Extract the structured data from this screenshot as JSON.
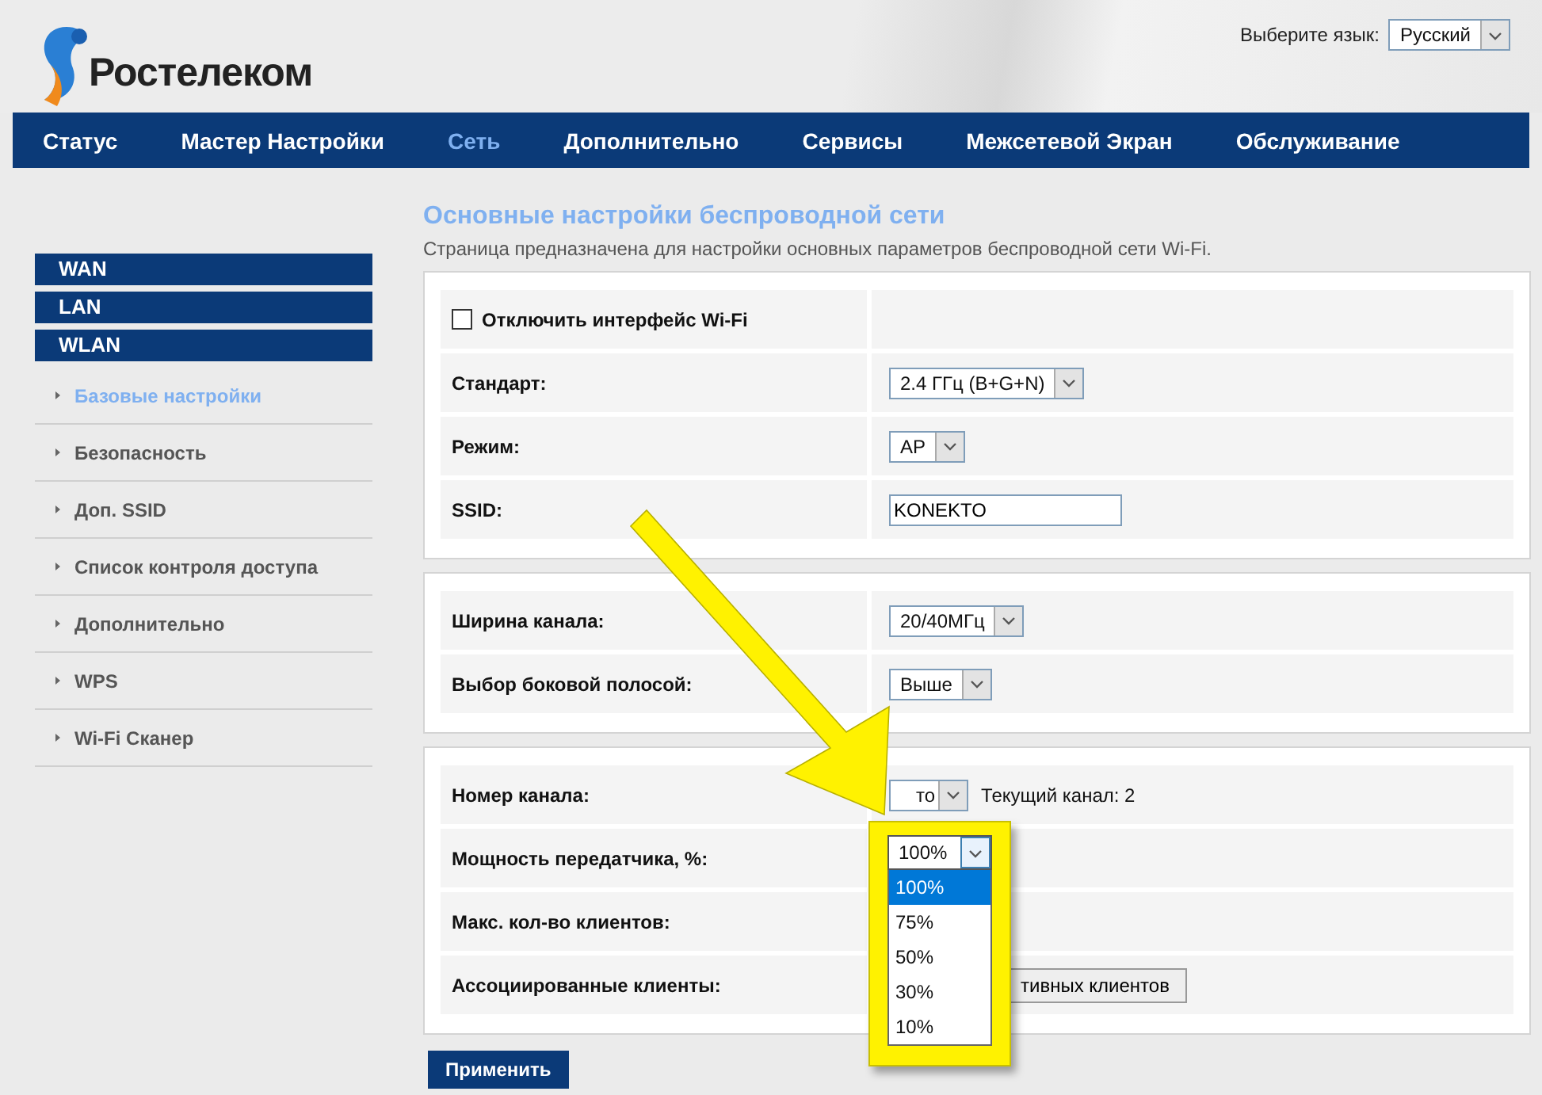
{
  "logo": {
    "text": "Ростелеком"
  },
  "language": {
    "label": "Выберите язык:",
    "value": "Русский"
  },
  "nav": [
    {
      "label": "Статус",
      "selected": false
    },
    {
      "label": "Мастер Настройки",
      "selected": false
    },
    {
      "label": "Сеть",
      "selected": true
    },
    {
      "label": "Дополнительно",
      "selected": false
    },
    {
      "label": "Сервисы",
      "selected": false
    },
    {
      "label": "Межсетевой Экран",
      "selected": false
    },
    {
      "label": "Обслуживание",
      "selected": false
    }
  ],
  "sidebar": {
    "groups": [
      "WAN",
      "LAN",
      "WLAN"
    ],
    "items": [
      {
        "label": "Базовые настройки",
        "selected": true
      },
      {
        "label": "Безопасность",
        "selected": false
      },
      {
        "label": "Доп. SSID",
        "selected": false
      },
      {
        "label": "Список контроля доступа",
        "selected": false
      },
      {
        "label": "Дополнительно",
        "selected": false
      },
      {
        "label": "WPS",
        "selected": false
      },
      {
        "label": "Wi-Fi Сканер",
        "selected": false
      }
    ]
  },
  "page": {
    "title": "Основные настройки беспроводной сети",
    "subtitle": "Страница предназначена для настройки основных параметров беспроводной сети Wi-Fi."
  },
  "sections": [
    {
      "rows": [
        {
          "kind": "checkbox",
          "label": "Отключить интерфейс Wi-Fi",
          "checked": false
        },
        {
          "kind": "select",
          "label": "Стандарт:",
          "value": "2.4 ГГц (B+G+N)"
        },
        {
          "kind": "select",
          "label": "Режим:",
          "value": "AP"
        },
        {
          "kind": "text",
          "label": "SSID:",
          "value": "KONEKTO"
        }
      ]
    },
    {
      "rows": [
        {
          "kind": "select",
          "label": "Ширина канала:",
          "value": "20/40МГц"
        },
        {
          "kind": "select",
          "label": "Выбор боковой полосой:",
          "value": "Выше"
        }
      ]
    },
    {
      "rows": [
        {
          "kind": "select",
          "label": "Номер канала:",
          "value": "то",
          "note": "Текущий канал: 2"
        },
        {
          "kind": "select",
          "label": "Мощность передатчика, %:",
          "value": "100%",
          "open": true,
          "options": [
            {
              "label": "100%",
              "selected": true
            },
            {
              "label": "75%",
              "selected": false
            },
            {
              "label": "50%",
              "selected": false
            },
            {
              "label": "30%",
              "selected": false
            },
            {
              "label": "10%",
              "selected": false
            }
          ]
        },
        {
          "kind": "empty",
          "label": "Макс. кол-во клиентов:"
        },
        {
          "kind": "button",
          "label": "Ассоциированные клиенты:",
          "value": "тивных клиентов"
        }
      ]
    }
  ],
  "apply": "Применить",
  "annotation": {
    "kind": "arrow"
  }
}
